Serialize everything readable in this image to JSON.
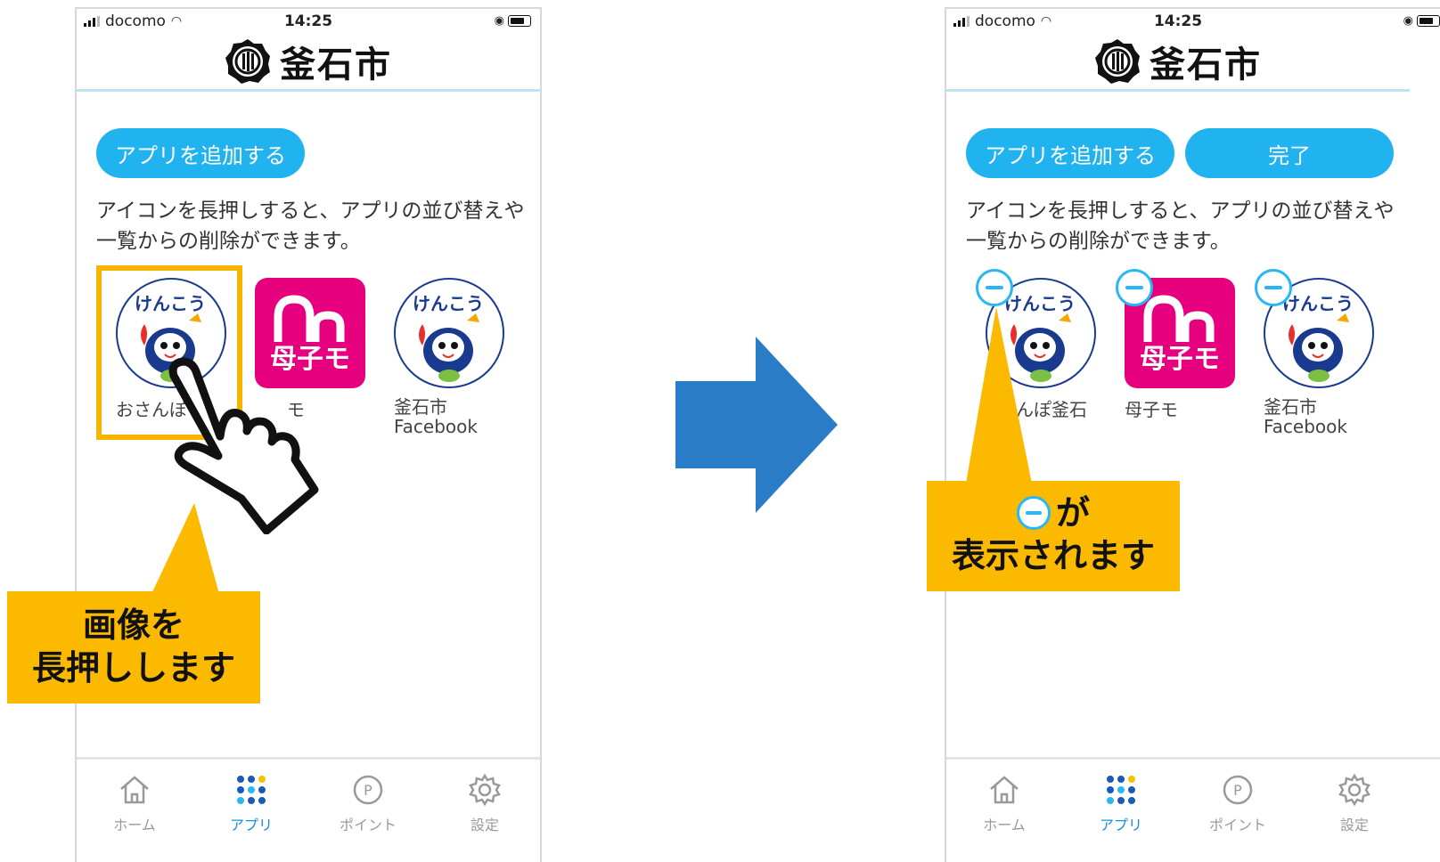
{
  "status_bar": {
    "carrier": "docomo",
    "time": "14:25"
  },
  "header": {
    "title": "釜石市"
  },
  "buttons": {
    "add_app": "アプリを追加する",
    "done": "完了"
  },
  "description": "アイコンを長押しすると、アプリの並び替えや一覧からの削除ができます。",
  "apps": [
    {
      "label": "おさんぽ釜石",
      "icon": "kenkou-mascot-icon"
    },
    {
      "label": "母子モ",
      "icon": "boshimo-icon",
      "mark": "母子モ"
    },
    {
      "label": "釜石市\nFacebook",
      "icon": "kenkou-mascot-icon"
    }
  ],
  "left_visible_labels": {
    "app1": "おさんぽ",
    "app2": "モ"
  },
  "right_visible_labels": {
    "app1": "んぽ釜石"
  },
  "mascot_text": "けんこう",
  "tabs": [
    {
      "label": "ホーム",
      "icon": "home-icon"
    },
    {
      "label": "アプリ",
      "icon": "apps-grid-icon",
      "active": true
    },
    {
      "label": "ポイント",
      "icon": "point-icon"
    },
    {
      "label": "設定",
      "icon": "gear-icon"
    }
  ],
  "callout_left": {
    "line1": "画像を",
    "line2": "長押しします"
  },
  "callout_right": {
    "line1": "が",
    "line2": "表示されます"
  },
  "colors": {
    "accent": "#20b3f0",
    "callout": "#fbb900",
    "arrow": "#2a7cc7",
    "boshimo": "#e6007e",
    "highlight": "#f7b500"
  }
}
